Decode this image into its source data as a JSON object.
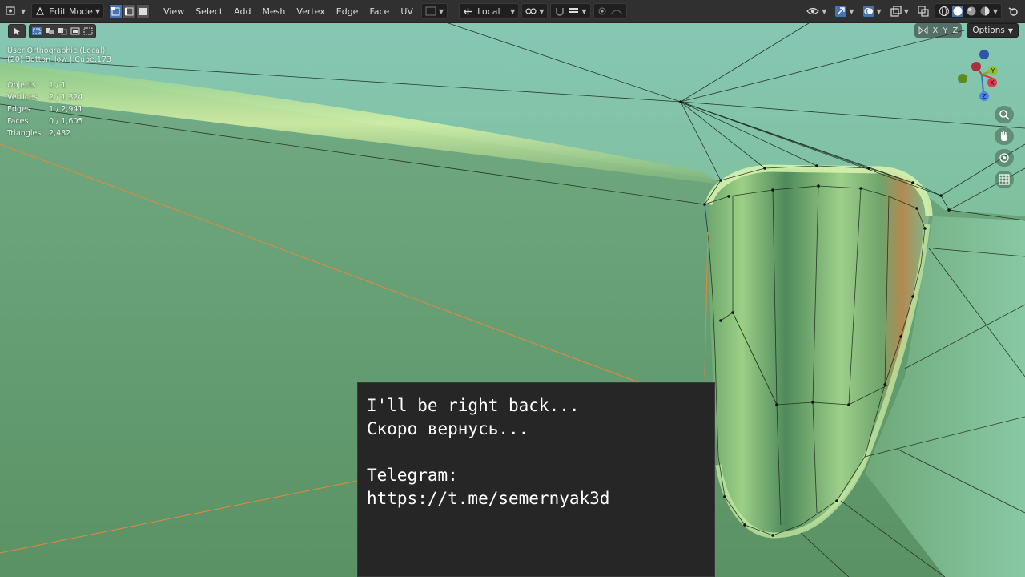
{
  "header": {
    "mode_label": "Edit Mode",
    "menus": [
      "View",
      "Select",
      "Add",
      "Mesh",
      "Vertex",
      "Edge",
      "Face",
      "UV"
    ],
    "transform_orientation": "Local"
  },
  "viewport": {
    "view_name": "User Orthographic (Local)",
    "object_label": "(20) Botton_low | Cube.173",
    "stats": [
      {
        "label": "Objects",
        "value": "1 / 1"
      },
      {
        "label": "Vertices",
        "value": "2 / 1,324"
      },
      {
        "label": "Edges",
        "value": "1 / 2,941"
      },
      {
        "label": "Faces",
        "value": "0 / 1,605"
      },
      {
        "label": "Triangles",
        "value": "2,482"
      }
    ],
    "axis_lock": [
      "X",
      "Y",
      "Z"
    ],
    "options_label": "Options",
    "gizmo": {
      "x_label": "X",
      "y_label": "Y",
      "z_label": "Z"
    }
  },
  "message": {
    "line1": "I'll be right back...",
    "line2": "Скоро вернусь...",
    "line3": "Telegram:",
    "line4": "https://t.me/semernyak3d"
  },
  "colors": {
    "header_bg": "#303030",
    "selection_blue": "#4772b3",
    "mesh_green": "#5e9468",
    "selected_edge_orange": "#e8873a"
  }
}
